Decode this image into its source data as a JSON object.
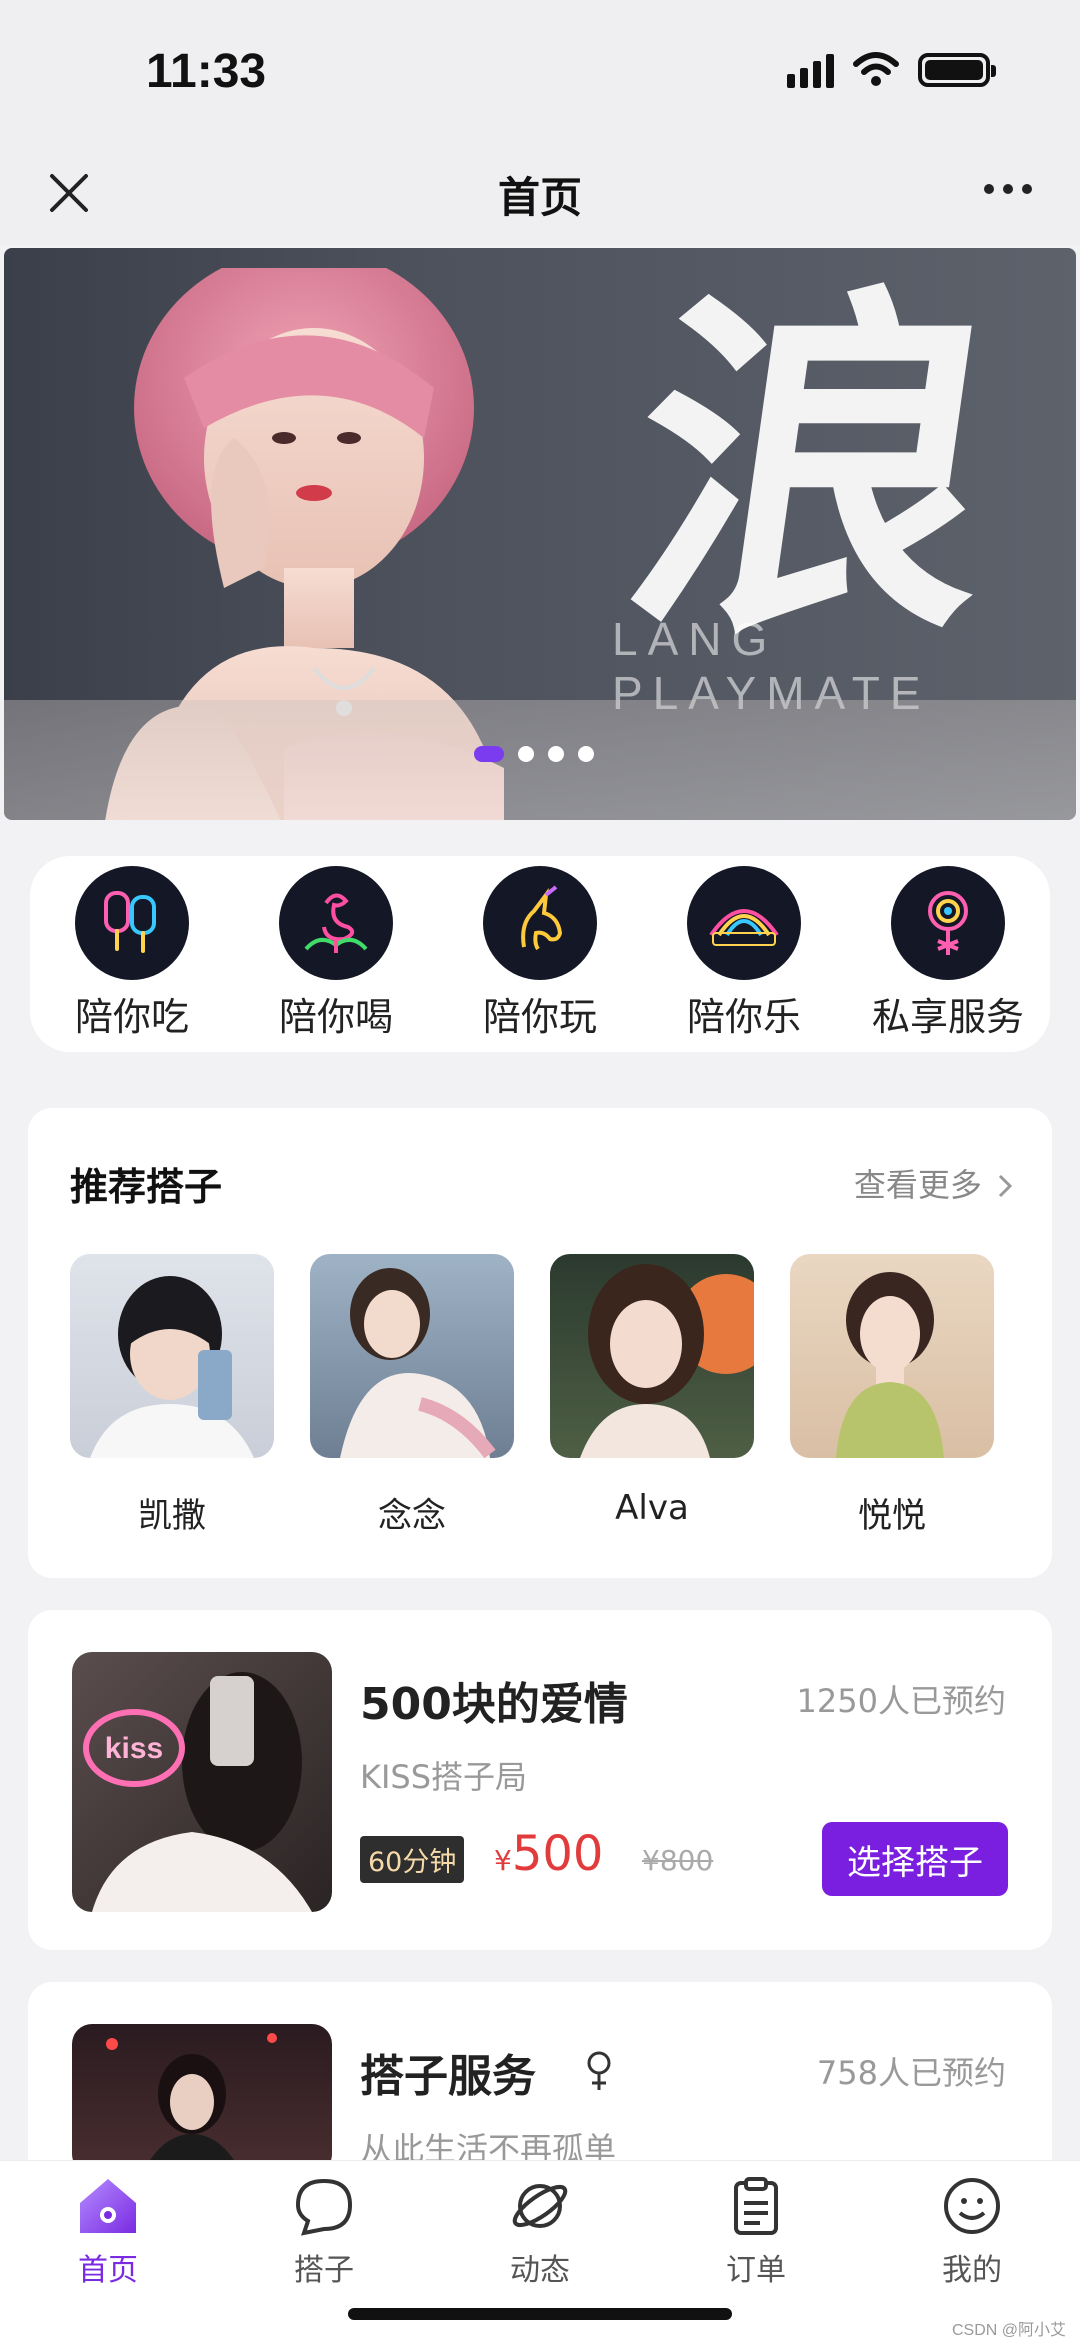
{
  "status_bar": {
    "time": "11:33"
  },
  "nav": {
    "title": "首页"
  },
  "banner": {
    "calligraphy": "浪",
    "subtitle": "LANG PLAYMATE",
    "dot_count": 4,
    "active_dot": 0
  },
  "categories": [
    {
      "label": "陪你吃",
      "icon": "popsicle-icon"
    },
    {
      "label": "陪你喝",
      "icon": "flamingo-icon"
    },
    {
      "label": "陪你玩",
      "icon": "unicorn-icon"
    },
    {
      "label": "陪你乐",
      "icon": "rainbow-icon"
    },
    {
      "label": "私享服务",
      "icon": "lollipop-icon"
    }
  ],
  "recommend": {
    "title": "推荐搭子",
    "more": "查看更多",
    "people": [
      {
        "name": "凯撒"
      },
      {
        "name": "念念"
      },
      {
        "name": "Alva"
      },
      {
        "name": "悦悦"
      }
    ]
  },
  "packages": [
    {
      "title": "500块的爱情",
      "booked": "1250人已预约",
      "subtitle": "KISS搭子局",
      "duration": "60分钟",
      "currency": "¥",
      "price": "500",
      "original_price": "¥800",
      "button": "选择搭子",
      "thumb_text": "kiss"
    },
    {
      "title": "搭子服务",
      "booked": "758人已预约",
      "subtitle": "从此生活不再孤单"
    }
  ],
  "tabs": [
    {
      "label": "首页",
      "icon": "home-icon",
      "active": true
    },
    {
      "label": "搭子",
      "icon": "chat-bubble-icon",
      "active": false
    },
    {
      "label": "动态",
      "icon": "planet-icon",
      "active": false
    },
    {
      "label": "订单",
      "icon": "clipboard-icon",
      "active": false
    },
    {
      "label": "我的",
      "icon": "smiley-icon",
      "active": false
    }
  ],
  "watermark": "CSDN @阿小艾",
  "colors": {
    "accent": "#7a1fe0",
    "price": "#e23b3b",
    "background": "#f2f2f5",
    "card": "#ffffff"
  }
}
